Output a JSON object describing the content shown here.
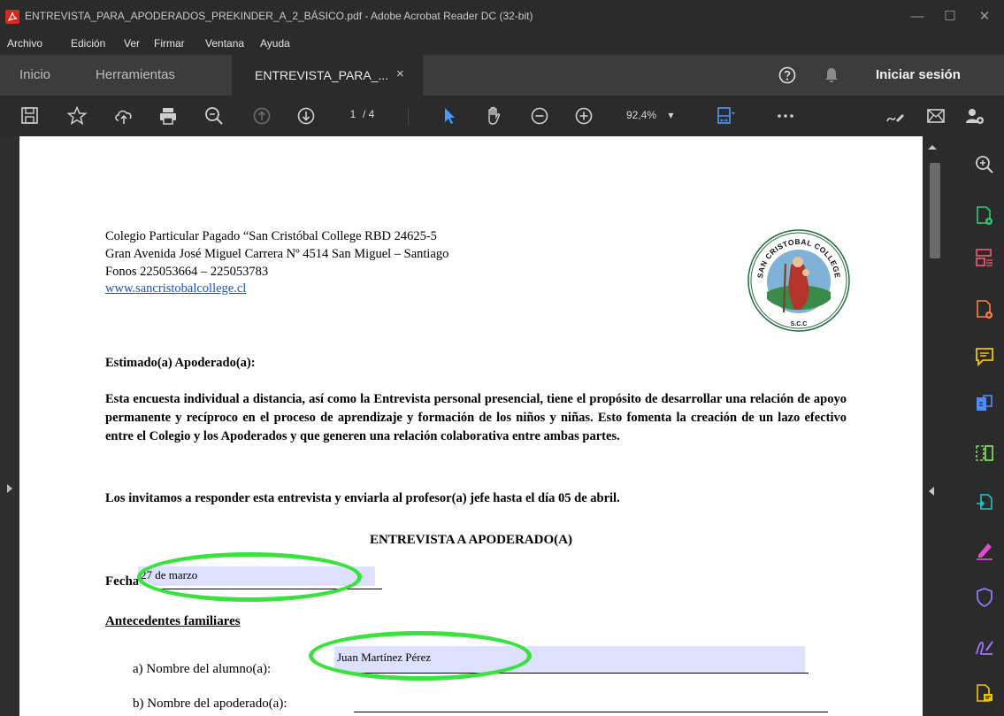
{
  "window": {
    "title": "ENTREVISTA_PARA_APODERADOS_PREKINDER_A_2_BÁSICO.pdf - Adobe Acrobat Reader DC (32-bit)",
    "minimize": "—",
    "maximize": "☐",
    "close": "✕"
  },
  "menu": [
    "Archivo",
    "Edición",
    "Ver",
    "Firmar",
    "Ventana",
    "Ayuda"
  ],
  "tabs": {
    "home": "Inicio",
    "tools": "Herramientas",
    "document": "ENTREVISTA_PARA_...",
    "close": "×",
    "signin": "Iniciar sesión"
  },
  "toolbar": {
    "current_page": "1",
    "total_pages": "/ 4",
    "zoom": "92,4%"
  },
  "document": {
    "header": [
      "Colegio Particular Pagado “San Cristóbal College RBD 24625-5",
      "Gran Avenida José Miguel Carrera Nº 4514 San Miguel – Santiago",
      "Fonos 225053664 – 225053783"
    ],
    "website": "www.sancristobalcollege.cl",
    "logo_text": "SAN CRISTOBAL COLLEGE",
    "logo_initials": "S.C.C",
    "greeting": "Estimado(a) Apoderado(a):",
    "paragraph1": "Esta encuesta individual a distancia, así como la Entrevista personal presencial, tiene el propósito de desarrollar una relación de apoyo permanente y recíproco en el proceso de aprendizaje y formación de los niños y niñas.  Esto fomenta la creación de un lazo efectivo entre el Colegio y los Apoderados y que generen una relación colaborativa entre ambas partes.",
    "paragraph2": "Los invitamos a responder esta entrevista y enviarla al profesor(a) jefe hasta el día 05 de abril.",
    "form_title": "ENTREVISTA A APODERADO(A)",
    "fecha_label": "Fecha:",
    "fecha_value": "27 de marzo",
    "section_title": "Antecedentes familiares",
    "item_a_label": "a)  Nombre del alumno(a):",
    "item_a_value": "Juan Martínez Pérez",
    "item_b_label": "b)  Nombre del apoderado(a):"
  },
  "colors": {
    "highlight_ring": "#39e23c",
    "form_field": "#dde1ff",
    "acrobat_red": "#d7261d",
    "tool_purple": "#a970ff",
    "tool_green": "#2ecc71",
    "tool_yellow": "#f5c400"
  }
}
